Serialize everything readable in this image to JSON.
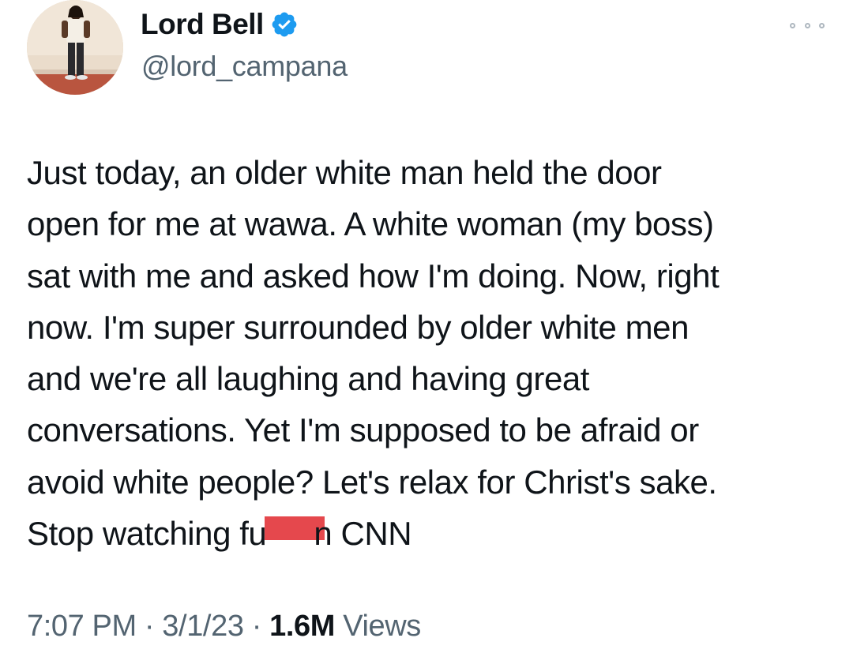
{
  "author": {
    "name": "Lord Bell",
    "handle": "@lord_campana",
    "verified": true,
    "verified_color": "#1d9bf0"
  },
  "tweet": {
    "lines": [
      "Just today, an older white man held the door",
      "open for me at wawa. A white woman (my boss)",
      "sat with me and asked how I'm doing. Now, right",
      "now. I'm super surrounded by older white men",
      "and we're all laughing and having great",
      "conversations. Yet I'm supposed to be afraid or",
      "avoid white people? Let's relax for Christ's sake."
    ],
    "last_line_before": "Stop watching fu",
    "last_line_after": "n CNN",
    "censor_color": "#e5484d"
  },
  "meta": {
    "time": "7:07 PM",
    "separator": " · ",
    "date": "3/1/23",
    "views_count": "1.6M",
    "views_label": " Views"
  },
  "icons": {
    "more": "more-horizontal-icon",
    "verified": "verified-badge-icon"
  }
}
